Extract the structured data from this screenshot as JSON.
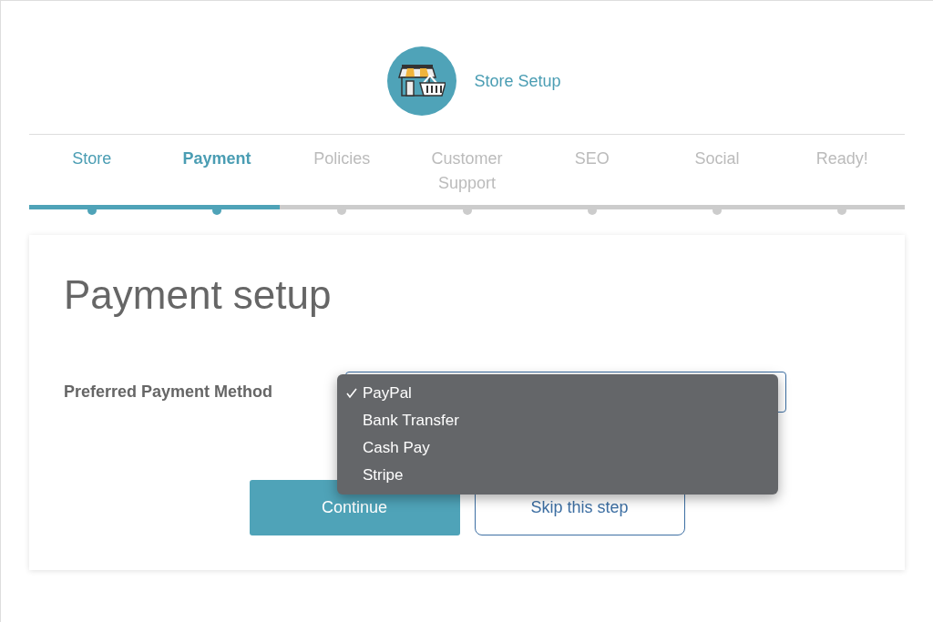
{
  "header": {
    "title": "Store Setup"
  },
  "steps": [
    {
      "label": "Store",
      "done": true,
      "selected": false
    },
    {
      "label": "Payment",
      "done": true,
      "selected": true
    },
    {
      "label": "Policies",
      "done": false,
      "selected": false
    },
    {
      "label": "Customer Support",
      "done": false,
      "selected": false
    },
    {
      "label": "SEO",
      "done": false,
      "selected": false
    },
    {
      "label": "Social",
      "done": false,
      "selected": false
    },
    {
      "label": "Ready!",
      "done": false,
      "selected": false
    }
  ],
  "card": {
    "heading": "Payment setup",
    "field_label": "Preferred Payment Method",
    "dropdown": {
      "expanded": true,
      "options": [
        {
          "label": "PayPal",
          "selected": true
        },
        {
          "label": "Bank Transfer",
          "selected": false
        },
        {
          "label": "Cash Pay",
          "selected": false
        },
        {
          "label": "Stripe",
          "selected": false
        }
      ]
    },
    "buttons": [
      {
        "label": "Continue",
        "kind": "primary"
      },
      {
        "label": "Skip this step",
        "kind": "secondary"
      }
    ]
  }
}
